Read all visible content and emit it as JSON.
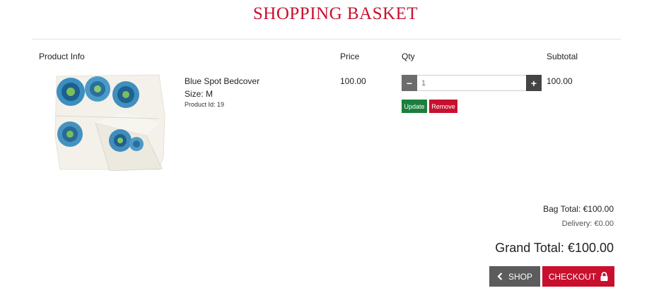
{
  "page": {
    "title": "SHOPPING BASKET"
  },
  "columns": {
    "product_info": "Product Info",
    "price": "Price",
    "qty": "Qty",
    "subtotal": "Subtotal"
  },
  "item": {
    "name": "Blue Spot Bedcover",
    "size": "Size: M",
    "product_id": "Product Id: 19",
    "price": "100.00",
    "quantity": "1",
    "subtotal": "100.00",
    "image_icon": "bedcover-photo"
  },
  "actions": {
    "update_label": "Update",
    "remove_label": "Remove",
    "decrement_symbol": "−",
    "increment_symbol": "+"
  },
  "totals": {
    "bag_total": "Bag Total: €100.00",
    "delivery": "Delivery: €0.00",
    "grand_total": "Grand Total: €100.00"
  },
  "nav": {
    "shop_label": "SHOP",
    "checkout_label": "CHECKOUT"
  },
  "colors": {
    "brand_red": "#c8102e",
    "update_green": "#1b7f3b",
    "shop_gray": "#5c5c5c"
  }
}
